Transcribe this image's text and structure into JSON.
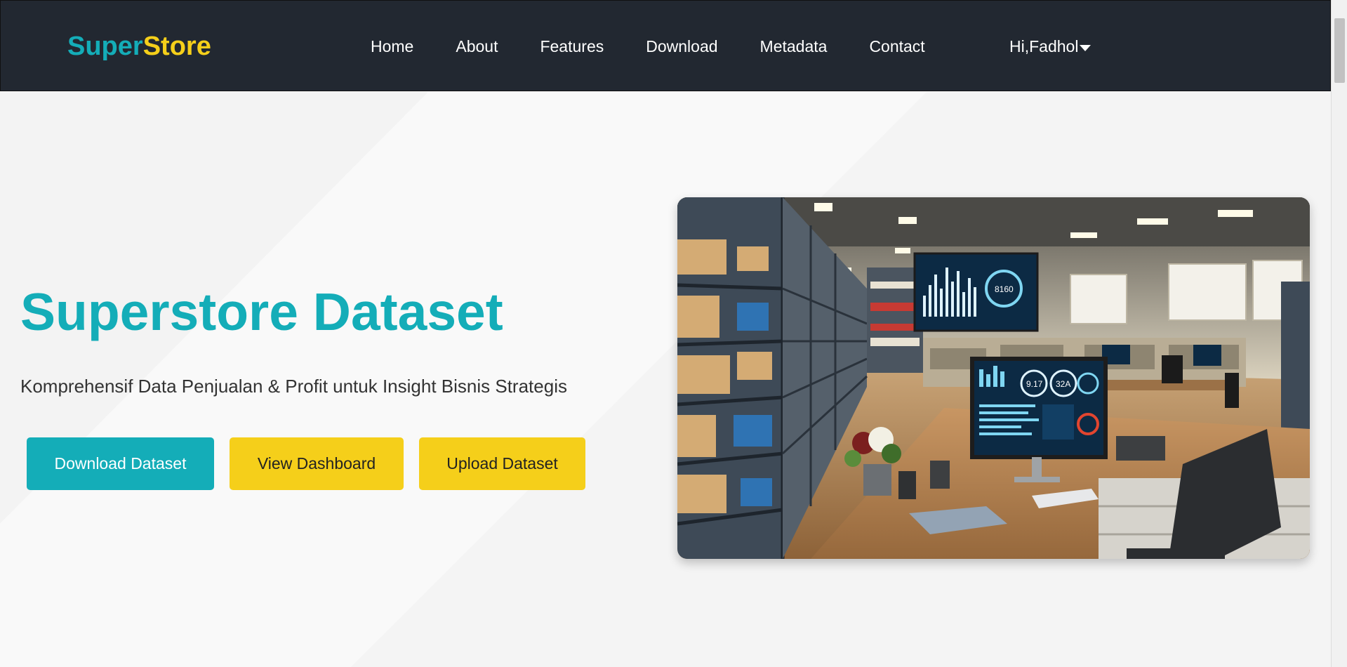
{
  "brand": {
    "part1": "Super",
    "part2": "Store"
  },
  "nav": {
    "items": [
      {
        "label": "Home"
      },
      {
        "label": "About"
      },
      {
        "label": "Features"
      },
      {
        "label": "Download"
      },
      {
        "label": "Metadata"
      },
      {
        "label": "Contact"
      }
    ],
    "user_greeting": "Hi,Fadhol"
  },
  "hero": {
    "title": "Superstore Dataset",
    "subtitle": "Komprehensif Data Penjualan & Profit untuk Insight Bisnis Strategis",
    "buttons": {
      "download": "Download Dataset",
      "dashboard": "View Dashboard",
      "upload": "Upload Dataset"
    },
    "image": {
      "monitor_stat_1": "9.17",
      "monitor_stat_2": "32A",
      "screen_stat": "8160"
    }
  },
  "colors": {
    "navbar_bg": "#222831",
    "accent_teal": "#14adb8",
    "accent_yellow": "#f5cf1a"
  }
}
